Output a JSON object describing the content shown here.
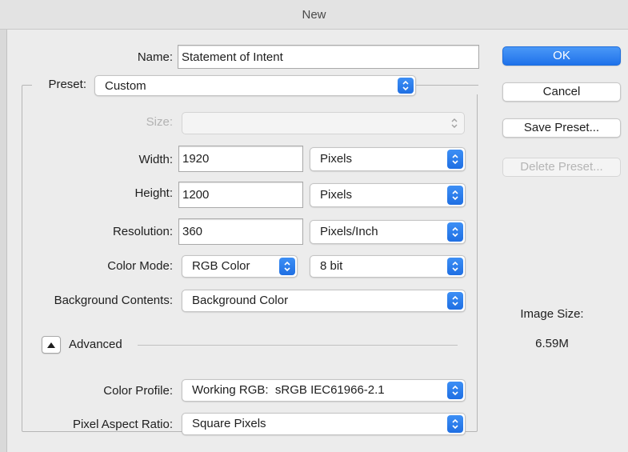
{
  "window": {
    "title": "New"
  },
  "name": {
    "label": "Name:",
    "value": "Statement of Intent"
  },
  "preset": {
    "label": "Preset:",
    "value": "Custom"
  },
  "size": {
    "label": "Size:",
    "value": ""
  },
  "width": {
    "label": "Width:",
    "value": "1920",
    "unit": "Pixels"
  },
  "height": {
    "label": "Height:",
    "value": "1200",
    "unit": "Pixels"
  },
  "resolution": {
    "label": "Resolution:",
    "value": "360",
    "unit": "Pixels/Inch"
  },
  "color_mode": {
    "label": "Color Mode:",
    "mode": "RGB Color",
    "depth": "8 bit"
  },
  "background": {
    "label": "Background Contents:",
    "value": "Background Color"
  },
  "advanced": {
    "label": "Advanced"
  },
  "color_profile": {
    "label": "Color Profile:",
    "value": "Working RGB:  sRGB IEC61966-2.1"
  },
  "pixel_aspect": {
    "label": "Pixel Aspect Ratio:",
    "value": "Square Pixels"
  },
  "buttons": {
    "ok": "OK",
    "cancel": "Cancel",
    "save_preset": "Save Preset...",
    "delete_preset": "Delete Preset..."
  },
  "image_size": {
    "label": "Image Size:",
    "value": "6.59M"
  },
  "colors": {
    "accent": "#2a7ff0",
    "background": "#ececec"
  },
  "icons": {
    "select_arrows": "updown-chevron-icon",
    "disclosure": "triangle-up-icon"
  }
}
